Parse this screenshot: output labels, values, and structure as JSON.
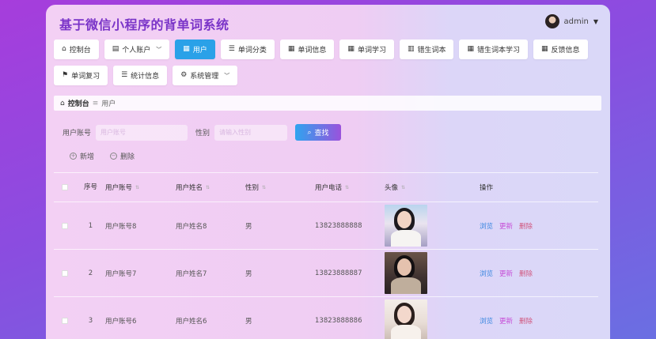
{
  "app": {
    "title": "基于微信小程序的背单词系统",
    "user": "admin"
  },
  "nav": {
    "row1": [
      {
        "icon": "⌂",
        "label": "控制台"
      },
      {
        "icon": "▤",
        "label": "个人账户"
      },
      {
        "icon": "▦",
        "label": "用户"
      },
      {
        "icon": "☰",
        "label": "单词分类"
      },
      {
        "icon": "▦",
        "label": "单词信息"
      },
      {
        "icon": "▦",
        "label": "单词学习"
      },
      {
        "icon": "▥",
        "label": "错生词本"
      },
      {
        "icon": "▦",
        "label": "错生词本学习"
      },
      {
        "icon": "▦",
        "label": "反馈信息"
      }
    ],
    "row2": [
      {
        "icon": "⚑",
        "label": "单词复习"
      },
      {
        "icon": "☰",
        "label": "统计信息"
      },
      {
        "icon": "⚙",
        "label": "系统管理"
      }
    ],
    "active": "用户"
  },
  "breadcrumb": {
    "home": "控制台",
    "current": "用户"
  },
  "search": {
    "account_label": "用户账号",
    "account_placeholder": "用户账号",
    "gender_label": "性别",
    "gender_placeholder": "请输入性别",
    "button": "查找"
  },
  "actions": {
    "add": "新增",
    "delete": "删除"
  },
  "table": {
    "headers": [
      "序号",
      "用户账号",
      "用户姓名",
      "性别",
      "用户电话",
      "头像",
      "操作"
    ],
    "rows": [
      {
        "idx": "1",
        "account": "用户账号8",
        "name": "用户姓名8",
        "gender": "男",
        "phone": "13823888888"
      },
      {
        "idx": "2",
        "account": "用户账号7",
        "name": "用户姓名7",
        "gender": "男",
        "phone": "13823888887"
      },
      {
        "idx": "3",
        "account": "用户账号6",
        "name": "用户姓名6",
        "gender": "男",
        "phone": "13823888886"
      }
    ],
    "ops": {
      "view": "浏览",
      "edit": "更新",
      "del": "删除"
    }
  }
}
